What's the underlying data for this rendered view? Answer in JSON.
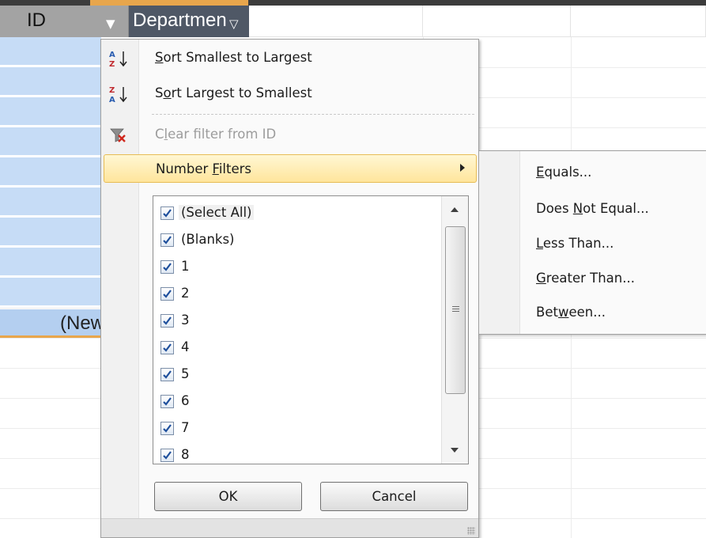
{
  "sheet": {
    "columns": [
      {
        "label": "ID",
        "active": false
      },
      {
        "label": "Departmen",
        "active": true
      }
    ],
    "new_row_label": "(New"
  },
  "menu": {
    "sort_asc": {
      "pre": "",
      "key": "S",
      "post": "ort Smallest to Largest",
      "icon": "sort-ascending-icon"
    },
    "sort_desc": {
      "pre": "S",
      "key": "o",
      "post": "rt Largest to Smallest",
      "icon": "sort-descending-icon"
    },
    "clear_filter": {
      "pre": "C",
      "key": "l",
      "post": "ear filter from ID",
      "icon": "clear-filter-icon",
      "disabled": true
    },
    "number_filters": {
      "pre": "Number ",
      "key": "F",
      "post": "ilters",
      "highlighted": true
    }
  },
  "filter_list": {
    "items": [
      {
        "label": "(Select All)",
        "checked": true
      },
      {
        "label": "(Blanks)",
        "checked": true
      },
      {
        "label": "1",
        "checked": true
      },
      {
        "label": "2",
        "checked": true
      },
      {
        "label": "3",
        "checked": true
      },
      {
        "label": "4",
        "checked": true
      },
      {
        "label": "5",
        "checked": true
      },
      {
        "label": "6",
        "checked": true
      },
      {
        "label": "7",
        "checked": true
      },
      {
        "label": "8",
        "checked": true
      }
    ]
  },
  "buttons": {
    "ok": "OK",
    "cancel": "Cancel"
  },
  "submenu": {
    "items": [
      {
        "pre": "",
        "key": "E",
        "post": "quals..."
      },
      {
        "pre": "Does ",
        "key": "N",
        "post": "ot Equal..."
      },
      {
        "pre": "",
        "key": "L",
        "post": "ess Than..."
      },
      {
        "pre": "",
        "key": "G",
        "post": "reater Than..."
      },
      {
        "pre": "Bet",
        "key": "w",
        "post": "een..."
      }
    ]
  },
  "colors": {
    "highlight": "#ffe59c",
    "selected_cell": "#c6dcf6",
    "active_header": "#4f5866"
  }
}
